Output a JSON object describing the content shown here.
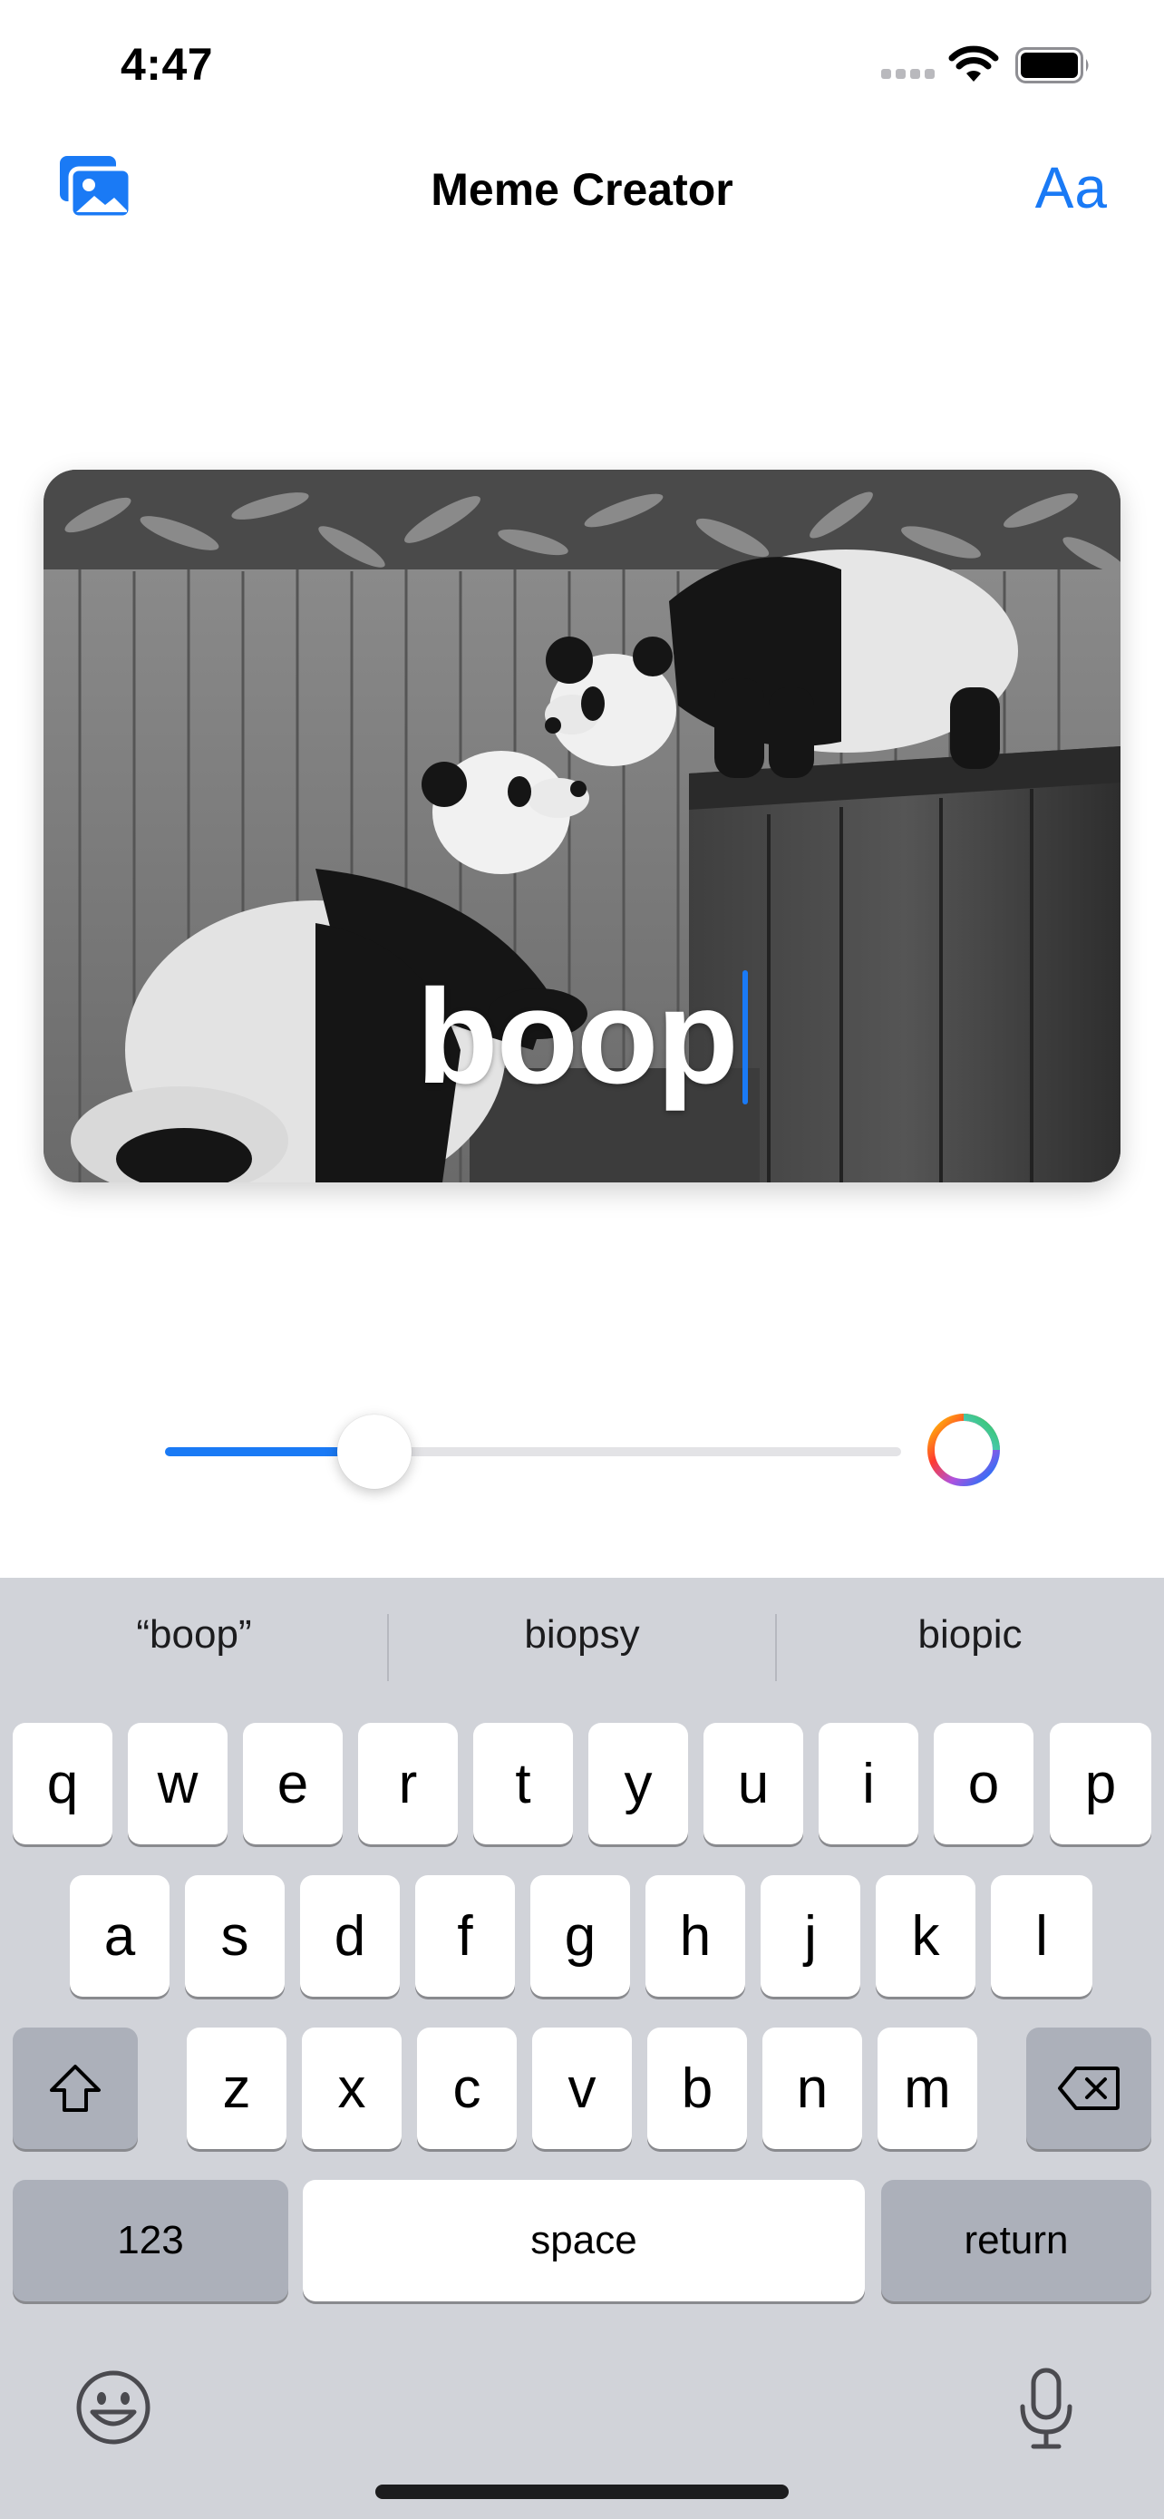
{
  "status_bar": {
    "time": "4:47"
  },
  "nav": {
    "title": "Meme Creator",
    "font_button_label": "Aa"
  },
  "meme": {
    "caption": "boop"
  },
  "slider": {
    "value_fraction": 0.27
  },
  "colors": {
    "accent": "#1a7af5",
    "keyboard_bg": "#d1d3d9"
  },
  "keyboard": {
    "suggestions": [
      "“boop”",
      "biopsy",
      "biopic"
    ],
    "row1": [
      "q",
      "w",
      "e",
      "r",
      "t",
      "y",
      "u",
      "i",
      "o",
      "p"
    ],
    "row2": [
      "a",
      "s",
      "d",
      "f",
      "g",
      "h",
      "j",
      "k",
      "l"
    ],
    "row3": [
      "z",
      "x",
      "c",
      "v",
      "b",
      "n",
      "m"
    ],
    "numbers_label": "123",
    "space_label": "space",
    "return_label": "return"
  },
  "icons": {
    "photos": "photo-library-icon",
    "shift": "shift-icon",
    "delete": "delete-icon",
    "emoji": "emoji-icon",
    "mic": "microphone-icon",
    "color": "color-picker-icon"
  }
}
